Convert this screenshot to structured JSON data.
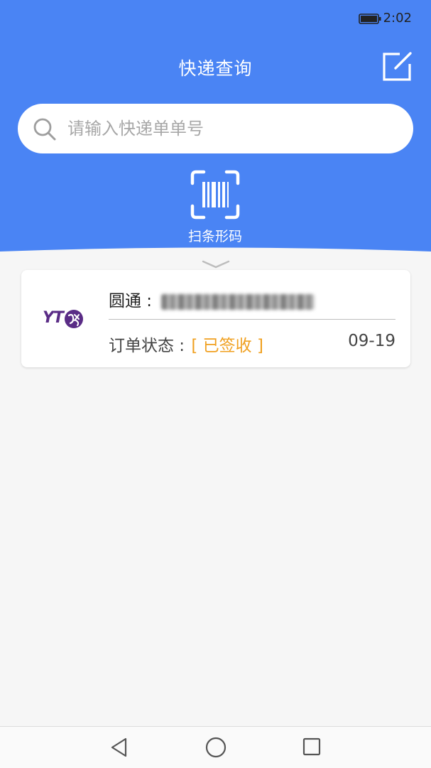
{
  "status_bar": {
    "time": "2:02",
    "battery_icon": "battery-icon"
  },
  "header": {
    "title": "快递查询",
    "edit_icon": "edit-icon",
    "accent_color": "#4a84f4"
  },
  "search": {
    "placeholder": "请输入快递单单号",
    "icon": "search-icon"
  },
  "scan": {
    "label": "扫条形码",
    "icon": "barcode-scan-icon"
  },
  "packages": [
    {
      "carrier_logo": "YT",
      "carrier_name": "圆通 : ",
      "tracking_number_obscured": true,
      "status_label": "订单状态 : ",
      "status_value": "[ 已签收 ]",
      "status_color": "#f0a020",
      "date": "09-19"
    }
  ],
  "nav_bar": {
    "back_icon": "back-triangle-icon",
    "home_icon": "home-circle-icon",
    "recents_icon": "recents-square-icon"
  }
}
